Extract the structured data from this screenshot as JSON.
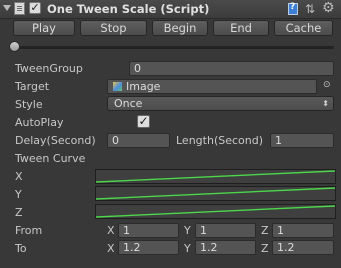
{
  "header": {
    "title": "One Tween Scale (Script)",
    "enabled_glyph": "✓",
    "icons": [
      "script-icon",
      "help-book-icon",
      "layout-icon",
      "gear-icon"
    ]
  },
  "buttons": [
    {
      "name": "play-button",
      "label": "Play"
    },
    {
      "name": "stop-button",
      "label": "Stop"
    },
    {
      "name": "begin-button",
      "label": "Begin"
    },
    {
      "name": "end-button",
      "label": "End"
    },
    {
      "name": "cache-button",
      "label": "Cache"
    }
  ],
  "progress": {
    "value": 0
  },
  "fields": {
    "tween_group": {
      "label": "TweenGroup",
      "value": "0"
    },
    "target": {
      "label": "Target",
      "value": "Image"
    },
    "style": {
      "label": "Style",
      "value": "Once"
    },
    "autoplay": {
      "label": "AutoPlay",
      "checked": true,
      "glyph": "✓"
    },
    "delay": {
      "label": "Delay(Second)",
      "value": "0"
    },
    "length": {
      "label": "Length(Second)",
      "value": "1"
    }
  },
  "curve": {
    "label": "Tween Curve",
    "axes": [
      {
        "label": "X",
        "color": "#4cd64c"
      },
      {
        "label": "Y",
        "color": "#4cd64c"
      },
      {
        "label": "Z",
        "color": "#4cd64c"
      }
    ]
  },
  "from": {
    "label": "From",
    "x": "1",
    "y": "1",
    "z": "1"
  },
  "to": {
    "label": "To",
    "x": "1.2",
    "y": "1.2",
    "z": "1.2"
  },
  "axis_letters": {
    "x": "X",
    "y": "Y",
    "z": "Z"
  },
  "colors": {
    "background": "#383838",
    "curve": "#4cd64c",
    "field": "#545454"
  }
}
